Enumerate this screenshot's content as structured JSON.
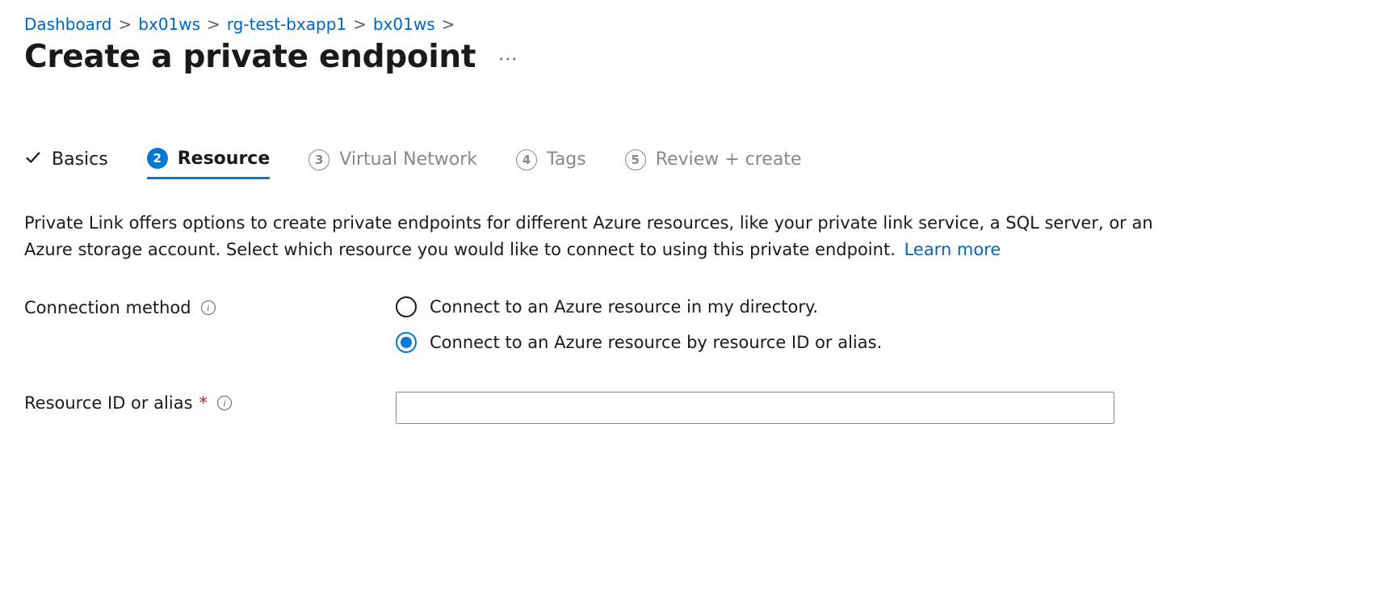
{
  "breadcrumb": {
    "items": [
      {
        "label": "Dashboard"
      },
      {
        "label": "bx01ws"
      },
      {
        "label": "rg-test-bxapp1"
      },
      {
        "label": "bx01ws"
      }
    ]
  },
  "page": {
    "title": "Create a private endpoint",
    "more_icon": "···"
  },
  "steps": [
    {
      "label": "Basics",
      "state": "completed"
    },
    {
      "label": "Resource",
      "state": "active",
      "index": "2"
    },
    {
      "label": "Virtual Network",
      "state": "upcoming",
      "index": "3"
    },
    {
      "label": "Tags",
      "state": "upcoming",
      "index": "4"
    },
    {
      "label": "Review + create",
      "state": "upcoming",
      "index": "5"
    }
  ],
  "description": {
    "text": "Private Link offers options to create private endpoints for different Azure resources, like your private link service, a SQL server, or an Azure storage account. Select which resource you would like to connect to using this private endpoint.",
    "learn_more": "Learn more"
  },
  "form": {
    "connection_method": {
      "label": "Connection method",
      "info_icon": "i",
      "options": [
        {
          "label": "Connect to an Azure resource in my directory.",
          "selected": false
        },
        {
          "label": "Connect to an Azure resource by resource ID or alias.",
          "selected": true
        }
      ]
    },
    "resource_id": {
      "label": "Resource ID or alias",
      "required_marker": "*",
      "info_icon": "i",
      "value": ""
    }
  }
}
